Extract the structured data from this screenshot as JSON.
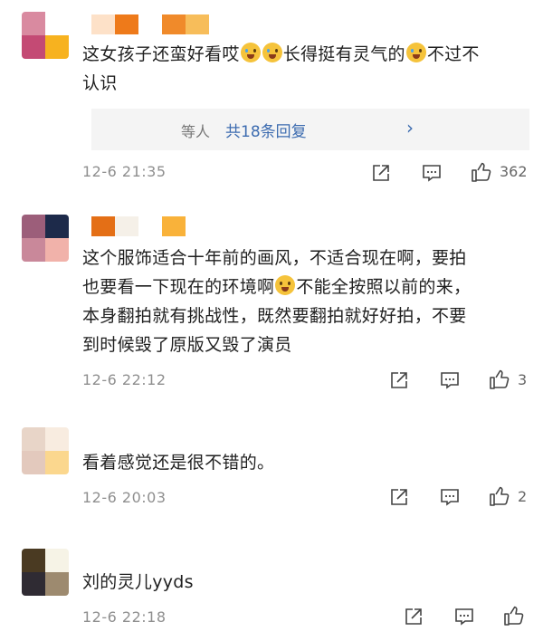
{
  "comments": [
    {
      "text_html_parts": [
        "这女孩子还蛮好看哎",
        "emoji",
        "emoji",
        "长得挺有灵气的",
        "emoji",
        "不过不认识"
      ],
      "line1": "这女孩子还蛮好看哎",
      "line1b": "长得挺有灵气的",
      "line1c": "不过不",
      "line2": "认识",
      "replies_prefix": "等人",
      "replies_link": "共18条回复",
      "timestamp": "12-6 21:35",
      "likes": "362"
    },
    {
      "line1": "这个服饰适合十年前的画风，不适合现在啊，要拍",
      "line2a": "也要看一下现在的环境啊",
      "line2b": "不能全按照以前的来，",
      "line3": "本身翻拍就有挑战性，既然要翻拍就好好拍，不要",
      "line4": "到时候毁了原版又毁了演员",
      "timestamp": "12-6 22:12",
      "likes": "3"
    },
    {
      "line1": "看着感觉还是很不错的。",
      "timestamp": "12-6 20:03",
      "likes": "2"
    },
    {
      "line1": "刘的灵儿yyds",
      "timestamp": "12-6 22:18",
      "likes": ""
    }
  ],
  "icons": [
    "share-icon",
    "comment-icon",
    "like-icon"
  ],
  "colors": {
    "link": "#3d6cb0",
    "meta": "#8f8f8f",
    "reply_bg": "#f4f4f4"
  }
}
